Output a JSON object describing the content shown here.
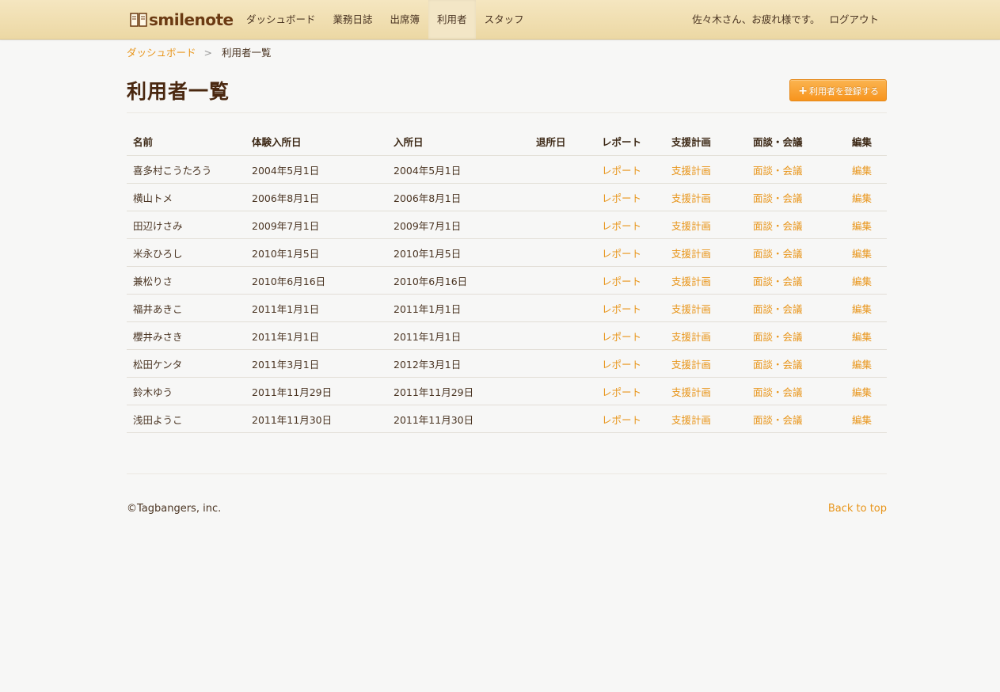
{
  "brand": {
    "name": "smilenote"
  },
  "nav": {
    "items": [
      {
        "label": "ダッシュボード",
        "active": false
      },
      {
        "label": "業務日誌",
        "active": false
      },
      {
        "label": "出席簿",
        "active": false
      },
      {
        "label": "利用者",
        "active": true
      },
      {
        "label": "スタッフ",
        "active": false
      }
    ],
    "greeting": "佐々木さん、お疲れ様です。",
    "logout": "ログアウト"
  },
  "breadcrumb": {
    "home": "ダッシュボード",
    "separator": ">",
    "current": "利用者一覧"
  },
  "page": {
    "title": "利用者一覧",
    "add_button": "利用者を登録する"
  },
  "table": {
    "headers": [
      "名前",
      "体験入所日",
      "入所日",
      "退所日",
      "レポート",
      "支援計画",
      "面談・会議",
      "編集"
    ],
    "rows": [
      {
        "name": "喜多村こうたろう",
        "trial": "2004年5月1日",
        "admission": "2004年5月1日",
        "discharge": "",
        "report": "レポート",
        "plan": "支援計画",
        "meeting": "面談・会議",
        "edit": "編集"
      },
      {
        "name": "横山トメ",
        "trial": "2006年8月1日",
        "admission": "2006年8月1日",
        "discharge": "",
        "report": "レポート",
        "plan": "支援計画",
        "meeting": "面談・会議",
        "edit": "編集"
      },
      {
        "name": "田辺けさみ",
        "trial": "2009年7月1日",
        "admission": "2009年7月1日",
        "discharge": "",
        "report": "レポート",
        "plan": "支援計画",
        "meeting": "面談・会議",
        "edit": "編集"
      },
      {
        "name": "米永ひろし",
        "trial": "2010年1月5日",
        "admission": "2010年1月5日",
        "discharge": "",
        "report": "レポート",
        "plan": "支援計画",
        "meeting": "面談・会議",
        "edit": "編集"
      },
      {
        "name": "兼松りさ",
        "trial": "2010年6月16日",
        "admission": "2010年6月16日",
        "discharge": "",
        "report": "レポート",
        "plan": "支援計画",
        "meeting": "面談・会議",
        "edit": "編集"
      },
      {
        "name": "福井あきこ",
        "trial": "2011年1月1日",
        "admission": "2011年1月1日",
        "discharge": "",
        "report": "レポート",
        "plan": "支援計画",
        "meeting": "面談・会議",
        "edit": "編集"
      },
      {
        "name": "櫻井みさき",
        "trial": "2011年1月1日",
        "admission": "2011年1月1日",
        "discharge": "",
        "report": "レポート",
        "plan": "支援計画",
        "meeting": "面談・会議",
        "edit": "編集"
      },
      {
        "name": "松田ケンタ",
        "trial": "2011年3月1日",
        "admission": "2012年3月1日",
        "discharge": "",
        "report": "レポート",
        "plan": "支援計画",
        "meeting": "面談・会議",
        "edit": "編集"
      },
      {
        "name": "鈴木ゆう",
        "trial": "2011年11月29日",
        "admission": "2011年11月29日",
        "discharge": "",
        "report": "レポート",
        "plan": "支援計画",
        "meeting": "面談・会議",
        "edit": "編集"
      },
      {
        "name": "浅田ようこ",
        "trial": "2011年11月30日",
        "admission": "2011年11月30日",
        "discharge": "",
        "report": "レポート",
        "plan": "支援計画",
        "meeting": "面談・会議",
        "edit": "編集"
      }
    ]
  },
  "footer": {
    "copyright": "©Tagbangers, inc.",
    "back_to_top": "Back to top"
  },
  "colors": {
    "accent": "#e8951a",
    "button": "#f7941d",
    "text": "#4a3422"
  }
}
